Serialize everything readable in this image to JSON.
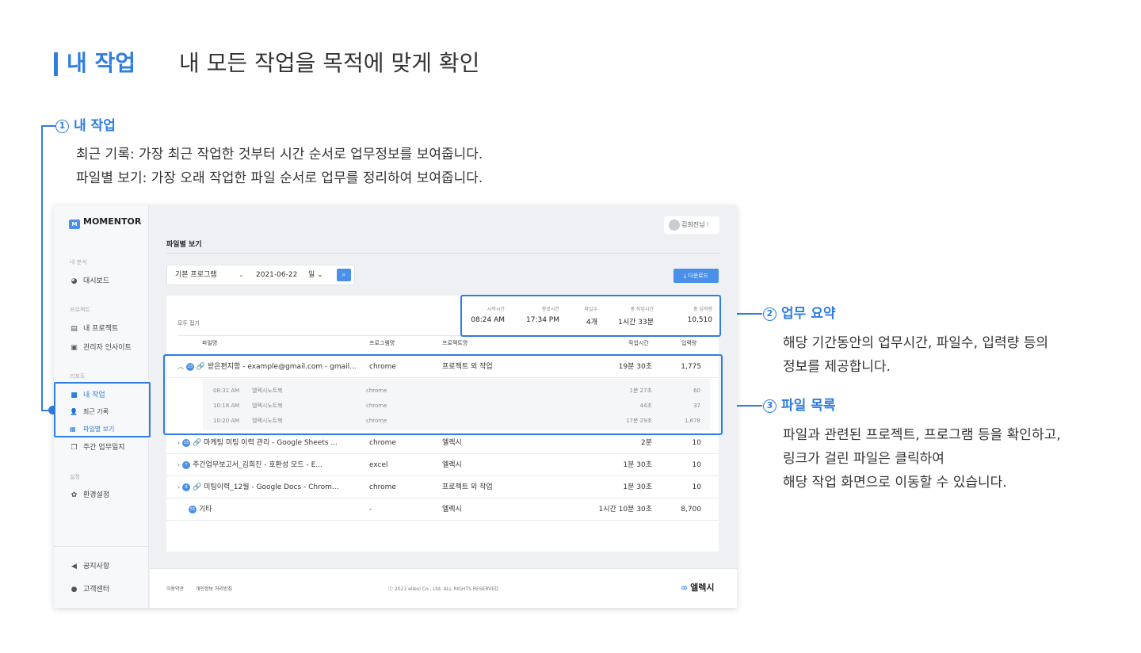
{
  "header": {
    "title": "내 작업",
    "subtitle": "내 모든 작업을 목적에 맞게 확인"
  },
  "callouts": [
    {
      "num": "1",
      "title": "내 작업",
      "lines": [
        "최근 기록: 가장 최근 작업한 것부터 시간 순서로 업무정보를 보여줍니다.",
        "파일별 보기: 가장 오래 작업한 파일 순서로 업무를 정리하여 보여줍니다."
      ]
    },
    {
      "num": "2",
      "title": "업무 요약",
      "lines": [
        "해당 기간동안의 업무시간, 파일수, 입력량 등의",
        "정보를 제공합니다."
      ]
    },
    {
      "num": "3",
      "title": "파일 목록",
      "lines": [
        "파일과 관련된 프로젝트, 프로그램 등을 확인하고,",
        "링크가 걸린 파일은 클릭하여",
        "해당 작업 화면으로 이동할 수 있습니다."
      ]
    }
  ],
  "app": {
    "brand": "MOMENTOR",
    "user": "김희진님",
    "sidebar": {
      "groups": [
        {
          "label": "내 분석",
          "items": [
            {
              "label": "대시보드",
              "icon": "pie-icon"
            }
          ]
        },
        {
          "label": "프로젝트",
          "items": [
            {
              "label": "내 프로젝트",
              "icon": "folder-stack-icon"
            },
            {
              "label": "관리자 인사이트",
              "icon": "insight-icon"
            }
          ]
        },
        {
          "label": "리포트",
          "items": [
            {
              "label": "내 작업",
              "icon": "folder-icon"
            }
          ]
        },
        {
          "label": "설정",
          "items": [
            {
              "label": "환경설정",
              "icon": "gear-icon"
            }
          ]
        }
      ],
      "sub_items": [
        {
          "label": "최근 기록"
        },
        {
          "label": "파일별 보기"
        }
      ],
      "weekly": "주간 업무일지",
      "bottom": [
        {
          "label": "공지사항"
        },
        {
          "label": "고객센터"
        }
      ]
    },
    "page_name": "파일별 보기",
    "filter": {
      "program": "기본 프로그램",
      "date": "2021-06-22",
      "unit": "일"
    },
    "download": "다운로드",
    "collapse_all": "모두 접기",
    "summary": [
      {
        "label": "시작시간",
        "value": "08:24 AM"
      },
      {
        "label": "종료시간",
        "value": "17:34 PM"
      },
      {
        "label": "파일수",
        "value": "4개"
      },
      {
        "label": "총 작업시간",
        "value": "1시간 33분"
      },
      {
        "label": "총 입력량",
        "value": "10,510"
      }
    ],
    "table": {
      "headers": [
        "파일명",
        "프로그램명",
        "프로젝트명",
        "작업시간",
        "입력량"
      ],
      "rows": [
        {
          "badge": "23",
          "chev": "^",
          "name": "받은편지함 - example@gmail.com - gmail...",
          "program": "chrome",
          "project": "프로젝트 외 작업",
          "time": "19분 30초",
          "input": "1,775"
        },
        {
          "badge": "18",
          "chev": ">",
          "name": "마케팅 미팅 이력 관리 - Google Sheets ...",
          "program": "chrome",
          "project": "엘렉시",
          "time": "2분",
          "input": "10"
        },
        {
          "badge": "7",
          "chev": ">",
          "name": "주간업무보고서_김희진 - 호환성 모드 - E...",
          "program": "excel",
          "project": "엘렉시",
          "time": "1분 30초",
          "input": "10"
        },
        {
          "badge": "8",
          "chev": ">",
          "name": "미팅이력_12월 - Google Docs - Chrom...",
          "program": "chrome",
          "project": "프로젝트 외 작업",
          "time": "1분 30초",
          "input": "10"
        },
        {
          "badge": "55",
          "chev": "",
          "name": "기타",
          "program": "-",
          "project": "엘렉시",
          "time": "1시간 10분 30초",
          "input": "8,700"
        }
      ],
      "sub_rows": [
        {
          "time_of_day": "08:31 AM",
          "name": "엘렉시노트북",
          "program": "chrome",
          "time": "1분 27초",
          "input": "60"
        },
        {
          "time_of_day": "10:18 AM",
          "name": "엘렉시노트북",
          "program": "chrome",
          "time": "44초",
          "input": "37"
        },
        {
          "time_of_day": "10:20 AM",
          "name": "엘렉시노트북",
          "program": "chrome",
          "time": "17분 29초",
          "input": "1,678"
        }
      ]
    },
    "footer": {
      "terms": "이용약관",
      "privacy": "개인정보 처리방침",
      "copyright": "ⓒ 2021 ellexi Co., Ltd. ALL RIGHTS RESERVED",
      "brand": "엘렉시"
    }
  }
}
